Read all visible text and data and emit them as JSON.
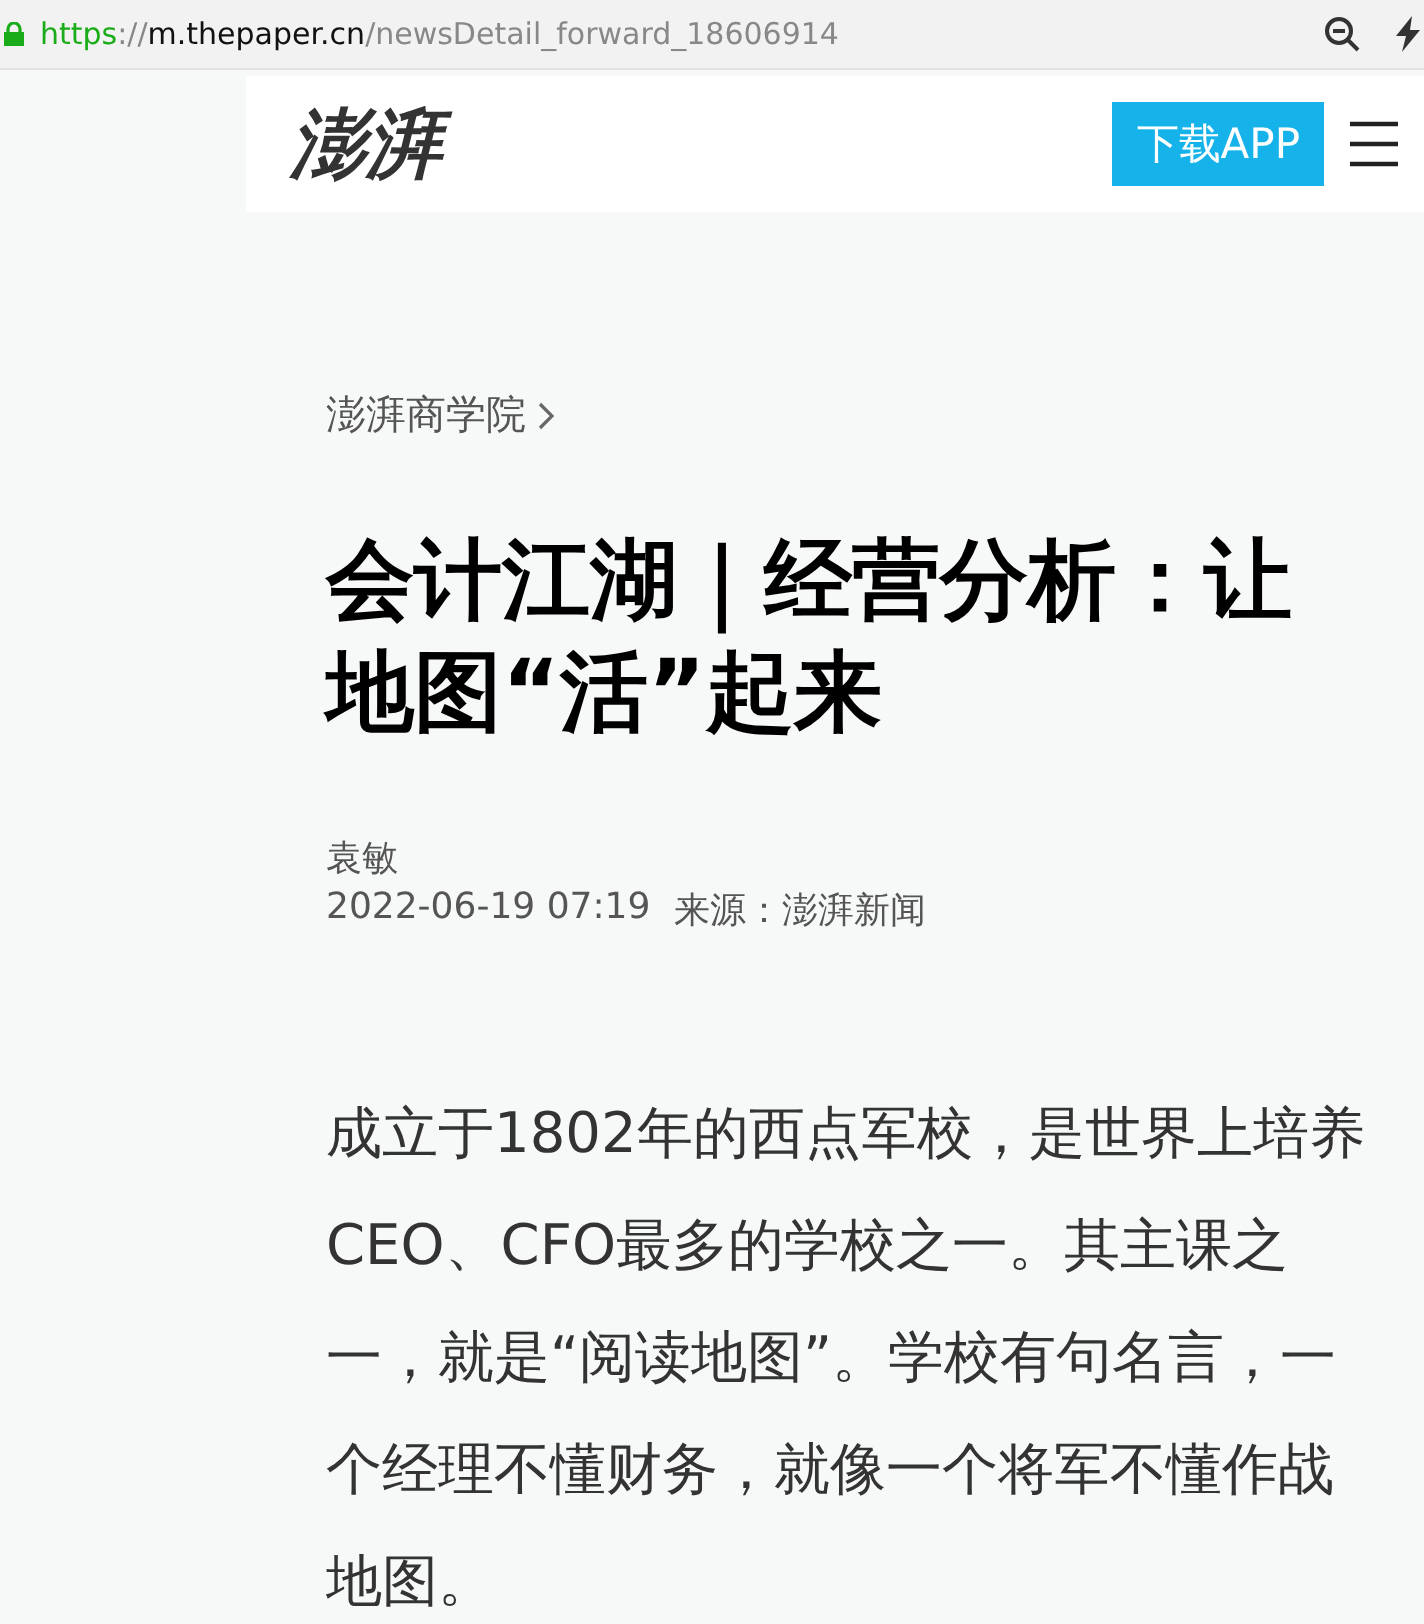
{
  "address_bar": {
    "secure": true,
    "url_parts": [
      {
        "text": "https",
        "kind": "scheme"
      },
      {
        "text": "://",
        "kind": "separator"
      },
      {
        "text": "m.thepaper.cn",
        "kind": "host"
      },
      {
        "text": "/newsDetail_forward_18606914",
        "kind": "path"
      }
    ]
  },
  "header": {
    "logo": "澎湃",
    "download_button": "下载APP"
  },
  "article": {
    "channel": "澎湃商学院",
    "title": "会计江湖｜经营分析：让地图“活”起来",
    "author": "袁敏",
    "date": "2022-06-19 07:19",
    "source": "来源：澎湃新闻",
    "body": "成立于1802年的西点军校，是世界上培养CEO、CFO最多的学校之一。其主课之一，就是“阅读地图”。学校有句名言，一个经理不懂财务，就像一个将军不懂作战地图。"
  }
}
